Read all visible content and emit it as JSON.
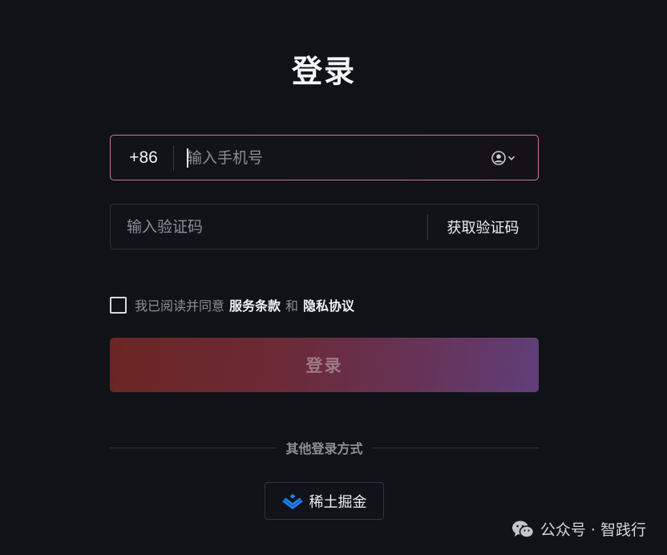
{
  "title": "登录",
  "phone": {
    "country_code": "+86",
    "placeholder": "输入手机号",
    "account_icon": "user-circle-icon"
  },
  "verification": {
    "placeholder": "输入验证码",
    "get_code_label": "获取验证码"
  },
  "agreement": {
    "prefix": "我已阅读并同意",
    "terms_label": "服务条款",
    "conjunction": "和",
    "privacy_label": "隐私协议",
    "checked": false
  },
  "login_button": {
    "label": "登录"
  },
  "other_login": {
    "label": "其他登录方式",
    "providers": [
      {
        "label": "稀土掘金",
        "icon": "juejin-logo-icon",
        "color": "#1e80ff"
      }
    ]
  },
  "watermark": {
    "text": "公众号 · 智践行",
    "icon": "wechat-icon"
  },
  "colors": {
    "background": "#101217",
    "focus_border": "#c77a98",
    "button_gradient_start": "#6b2523",
    "button_gradient_end": "#5f3f7a",
    "brand_blue": "#1e80ff"
  }
}
